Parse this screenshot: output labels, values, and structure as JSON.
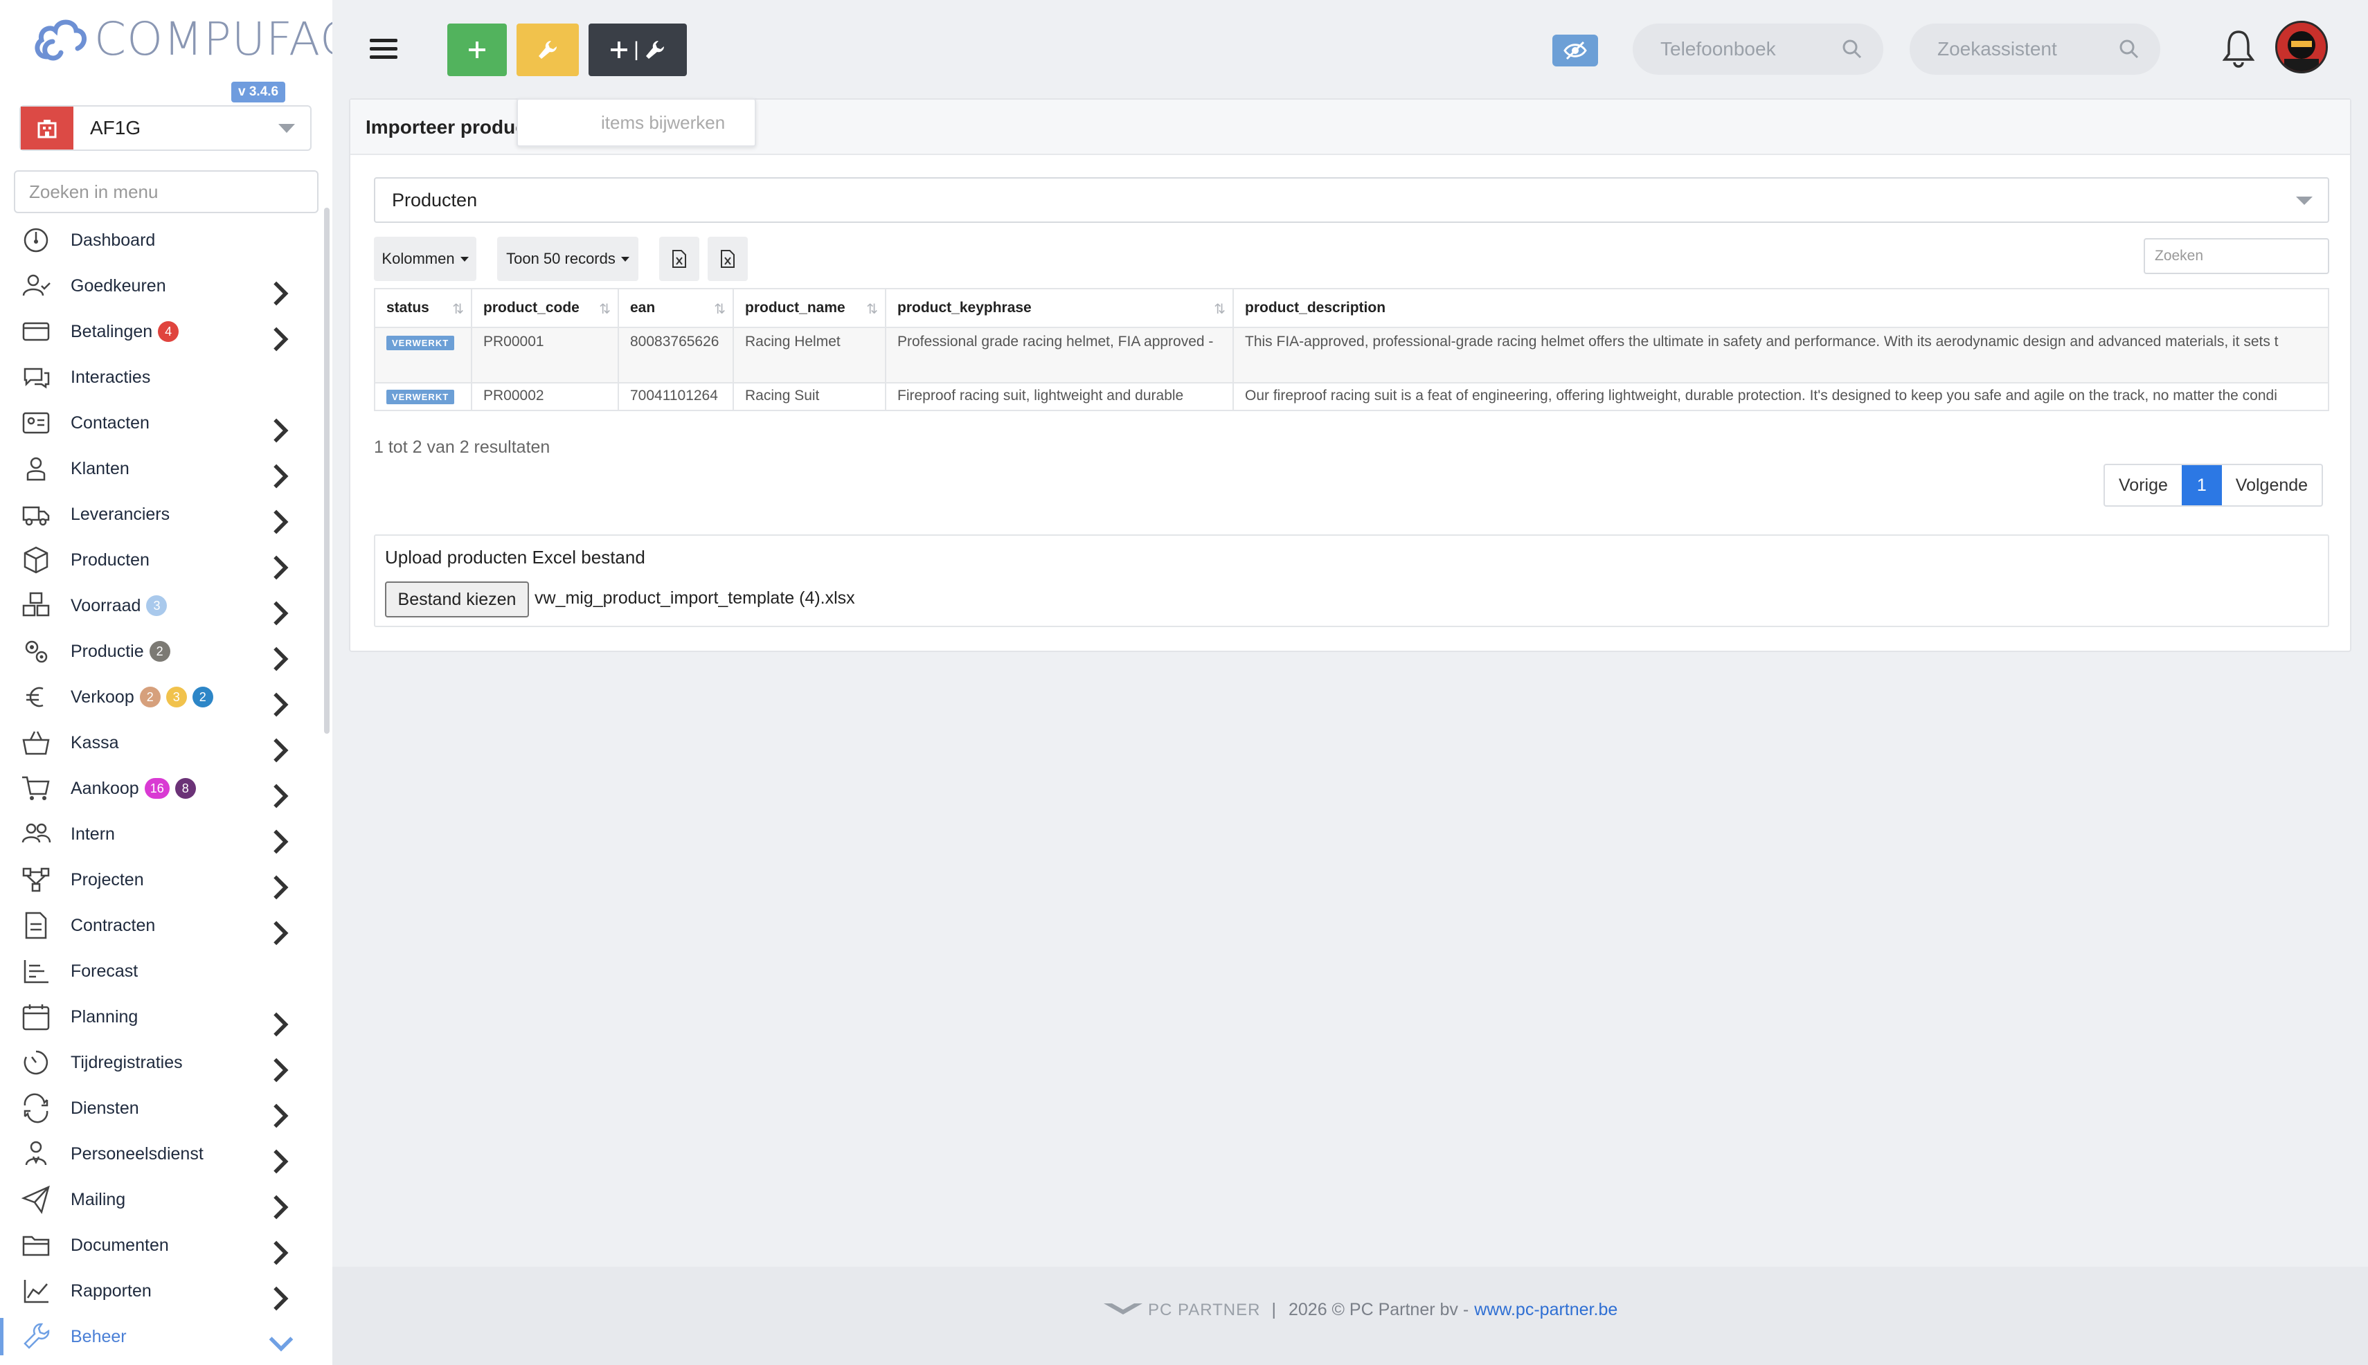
{
  "brand": {
    "name": "COMPUFACT",
    "version": "v 3.4.6"
  },
  "company": {
    "name": "AF1G"
  },
  "menu_search": {
    "placeholder": "Zoeken in menu"
  },
  "nav": [
    {
      "label": "Dashboard",
      "icon": "dashboard-icon",
      "chevron": false,
      "badges": []
    },
    {
      "label": "Goedkeuren",
      "icon": "user-check-icon",
      "chevron": true,
      "badges": []
    },
    {
      "label": "Betalingen",
      "icon": "payment-icon",
      "chevron": true,
      "badges": [
        {
          "v": "4",
          "c": "#e0443e"
        }
      ]
    },
    {
      "label": "Interacties",
      "icon": "chat-icon",
      "chevron": false,
      "badges": []
    },
    {
      "label": "Contacten",
      "icon": "contact-card-icon",
      "chevron": true,
      "badges": []
    },
    {
      "label": "Klanten",
      "icon": "customer-icon",
      "chevron": true,
      "badges": []
    },
    {
      "label": "Leveranciers",
      "icon": "truck-icon",
      "chevron": true,
      "badges": []
    },
    {
      "label": "Producten",
      "icon": "box-icon",
      "chevron": true,
      "badges": []
    },
    {
      "label": "Voorraad",
      "icon": "stock-icon",
      "chevron": true,
      "badges": [
        {
          "v": "3",
          "c": "#a9c9ec"
        }
      ]
    },
    {
      "label": "Productie",
      "icon": "gears-icon",
      "chevron": true,
      "badges": [
        {
          "v": "2",
          "c": "#7c7a74"
        }
      ]
    },
    {
      "label": "Verkoop",
      "icon": "euro-icon",
      "chevron": true,
      "badges": [
        {
          "v": "2",
          "c": "#d6a07c"
        },
        {
          "v": "3",
          "c": "#f1c24c"
        },
        {
          "v": "2",
          "c": "#2d86c7"
        }
      ]
    },
    {
      "label": "Kassa",
      "icon": "basket-icon",
      "chevron": true,
      "badges": []
    },
    {
      "label": "Aankoop",
      "icon": "cart-icon",
      "chevron": true,
      "badges": [
        {
          "v": "16",
          "c": "#d93ad3"
        },
        {
          "v": "8",
          "c": "#6b3277"
        }
      ]
    },
    {
      "label": "Intern",
      "icon": "users-icon",
      "chevron": true,
      "badges": []
    },
    {
      "label": "Projecten",
      "icon": "project-icon",
      "chevron": true,
      "badges": []
    },
    {
      "label": "Contracten",
      "icon": "contract-icon",
      "chevron": true,
      "badges": []
    },
    {
      "label": "Forecast",
      "icon": "forecast-icon",
      "chevron": false,
      "badges": []
    },
    {
      "label": "Planning",
      "icon": "calendar-icon",
      "chevron": true,
      "badges": []
    },
    {
      "label": "Tijdregistraties",
      "icon": "timer-icon",
      "chevron": true,
      "badges": []
    },
    {
      "label": "Diensten",
      "icon": "repeat-icon",
      "chevron": true,
      "badges": []
    },
    {
      "label": "Personeelsdienst",
      "icon": "staff-icon",
      "chevron": true,
      "badges": []
    },
    {
      "label": "Mailing",
      "icon": "send-icon",
      "chevron": true,
      "badges": []
    },
    {
      "label": "Documenten",
      "icon": "folder-icon",
      "chevron": true,
      "badges": []
    },
    {
      "label": "Rapporten",
      "icon": "chart-icon",
      "chevron": true,
      "badges": []
    },
    {
      "label": "Beheer",
      "icon": "wrench-icon",
      "chevron": true,
      "badges": [],
      "active": true
    }
  ],
  "topbar": {
    "tooltip": "items bijwerken",
    "phonebook_placeholder": "Telefoonboek",
    "assistant_placeholder": "Zoekassistent"
  },
  "card": {
    "title": "Importeer product-gegevens",
    "type_select": "Producten",
    "columns_btn": "Kolommen",
    "show_btn": "Toon 50 records",
    "search_placeholder": "Zoeken",
    "columns": [
      "status",
      "product_code",
      "ean",
      "product_name",
      "product_keyphrase",
      "product_description"
    ],
    "rows": [
      {
        "status": "VERWERKT",
        "product_code": "PR00001",
        "ean": "80083765626",
        "product_name": "Racing Helmet",
        "product_keyphrase": "Professional grade racing helmet, FIA approved -",
        "product_description": "This FIA-approved, professional-grade racing helmet offers the ultimate in safety and performance. With its aerodynamic design and advanced materials, it sets t"
      },
      {
        "status": "VERWERKT",
        "product_code": "PR00002",
        "ean": "70041101264",
        "product_name": "Racing Suit",
        "product_keyphrase": "Fireproof racing suit, lightweight and durable",
        "product_description": "Our fireproof racing suit is a feat of engineering, offering lightweight, durable protection. It's designed to keep you safe and agile on the track, no matter the condi"
      }
    ],
    "results_text": "1 tot 2 van 2 resultaten",
    "pager": {
      "prev": "Vorige",
      "page": "1",
      "next": "Volgende"
    },
    "upload": {
      "title": "Upload producten Excel bestand",
      "button": "Bestand kiezen",
      "file": "vw_mig_product_import_template (4).xlsx"
    }
  },
  "footer": {
    "logo": "PC PARTNER",
    "sep": "|",
    "copy": "2026 © PC Partner bv - ",
    "link": "www.pc-partner.be"
  },
  "colors": {
    "accent": "#2c78e4",
    "green": "#52b35d",
    "yellow": "#f1c24c",
    "dark": "#3a3f47",
    "status": "#6c9fd6"
  }
}
